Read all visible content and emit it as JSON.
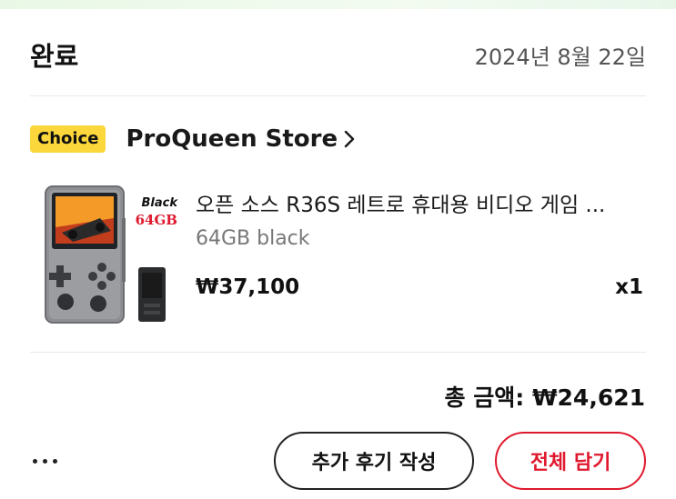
{
  "order": {
    "status": "완료",
    "date": "2024년 8월 22일"
  },
  "store": {
    "badge": "Choice",
    "name": "ProQueen Store"
  },
  "item": {
    "thumbnail": {
      "label_color_text": "Black",
      "label_capacity_text": "64GB"
    },
    "title": "오픈 소스 R36S 레트로 휴대용 비디오 게임 ...",
    "variant": "64GB black",
    "price": "₩37,100",
    "quantity": "x1"
  },
  "summary": {
    "total": "총 금액: ₩24,621"
  },
  "actions": {
    "more_icon": "ellipsis-icon",
    "review_label": "추가 후기 작성",
    "cart_all_label": "전체 담기"
  },
  "colors": {
    "choice_badge": "#fbd73b",
    "accent_red": "#e0182d",
    "muted_text": "#777777"
  }
}
